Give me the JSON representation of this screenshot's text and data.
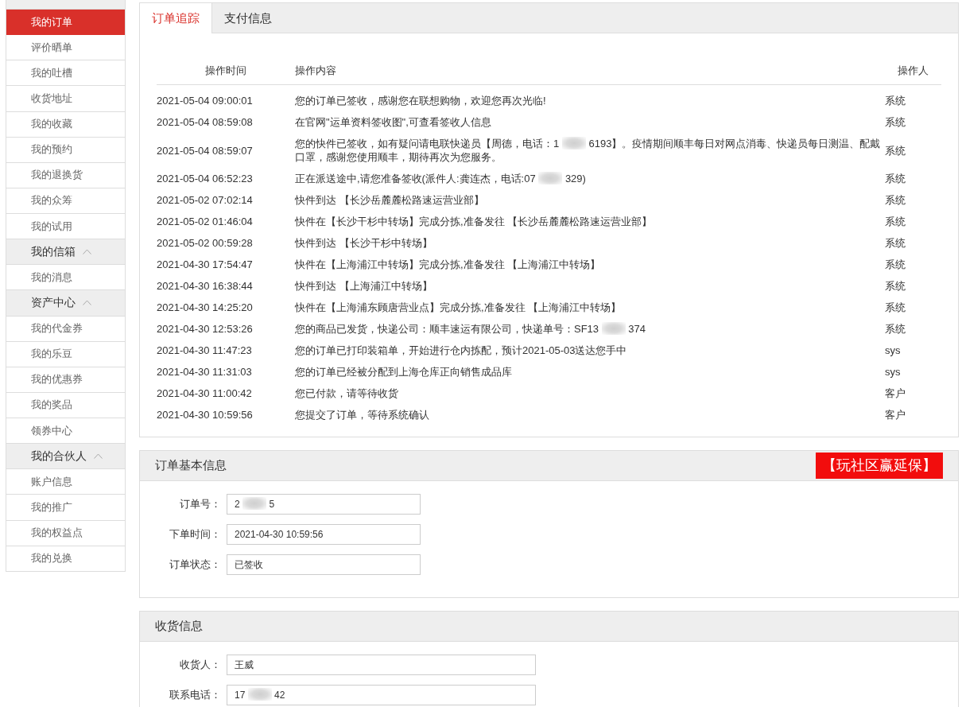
{
  "sidebar": {
    "groups": [
      {
        "items": [
          {
            "label": "我的订单",
            "selected": true
          },
          {
            "label": "评价晒单",
            "selected": false
          },
          {
            "label": "我的吐槽",
            "selected": false
          },
          {
            "label": "收货地址",
            "selected": false
          },
          {
            "label": "我的收藏",
            "selected": false
          },
          {
            "label": "我的预约",
            "selected": false
          },
          {
            "label": "我的退换货",
            "selected": false
          },
          {
            "label": "我的众筹",
            "selected": false
          },
          {
            "label": "我的试用",
            "selected": false
          }
        ]
      },
      {
        "title": "我的信箱",
        "expanded": true,
        "items": [
          {
            "label": "我的消息",
            "selected": false
          }
        ]
      },
      {
        "title": "资产中心",
        "expanded": true,
        "items": [
          {
            "label": "我的代金券",
            "selected": false
          },
          {
            "label": "我的乐豆",
            "selected": false
          },
          {
            "label": "我的优惠券",
            "selected": false
          },
          {
            "label": "我的奖品",
            "selected": false
          },
          {
            "label": "领券中心",
            "selected": false
          }
        ]
      },
      {
        "title": "我的合伙人",
        "expanded": true,
        "items": [
          {
            "label": "账户信息",
            "selected": false
          },
          {
            "label": "我的推广",
            "selected": false
          },
          {
            "label": "我的权益点",
            "selected": false
          },
          {
            "label": "我的兑换",
            "selected": false
          }
        ]
      }
    ]
  },
  "tracking": {
    "tabs": [
      {
        "label": "订单追踪",
        "selected": true
      },
      {
        "label": "支付信息",
        "selected": false
      }
    ],
    "table": {
      "columns": [
        "操作时间",
        "操作内容",
        "操作人"
      ],
      "rows": [
        {
          "time": "2021-05-04 09:00:01",
          "content": [
            "您的订单已签收，感谢您在联想购物，欢迎您再次光临!"
          ],
          "operator": "系统"
        },
        {
          "time": "2021-05-04 08:59:08",
          "content": [
            "在官网\"运单资料签收图\",可查看签收人信息"
          ],
          "operator": "系统"
        },
        {
          "time": "2021-05-04 08:59:07",
          "content": [
            "您的快件已签收，如有疑问请电联快递员【周德，电话：1",
            "6193】。疫情期间顺丰每日对网点消毒、快递员每日测温、配戴口罩，感谢您使用顺丰，期待再次为您服务。"
          ],
          "operator": "系统"
        },
        {
          "time": "2021-05-04 06:52:23",
          "content": [
            "正在派送途中,请您准备签收(派件人:龚连杰，电话:07",
            "329)"
          ],
          "operator": "系统"
        },
        {
          "time": "2021-05-02 07:02:14",
          "content": [
            "快件到达 【长沙岳麓麓松路速运营业部】"
          ],
          "operator": "系统"
        },
        {
          "time": "2021-05-02 01:46:04",
          "content": [
            "快件在【长沙干杉中转场】完成分拣,准备发往 【长沙岳麓麓松路速运营业部】"
          ],
          "operator": "系统"
        },
        {
          "time": "2021-05-02 00:59:28",
          "content": [
            "快件到达 【长沙干杉中转场】"
          ],
          "operator": "系统"
        },
        {
          "time": "2021-04-30 17:54:47",
          "content": [
            "快件在【上海浦江中转场】完成分拣,准备发往 【上海浦江中转场】"
          ],
          "operator": "系统"
        },
        {
          "time": "2021-04-30 16:38:44",
          "content": [
            "快件到达 【上海浦江中转场】"
          ],
          "operator": "系统"
        },
        {
          "time": "2021-04-30 14:25:20",
          "content": [
            "快件在【上海浦东顾唐营业点】完成分拣,准备发往 【上海浦江中转场】"
          ],
          "operator": "系统"
        },
        {
          "time": "2021-04-30 12:53:26",
          "content": [
            "您的商品已发货，快递公司：顺丰速运有限公司，快递单号：SF13",
            "374"
          ],
          "operator": "系统"
        },
        {
          "time": "2021-04-30 11:47:23",
          "content": [
            "您的订单已打印装箱单，开始进行仓内拣配，预计2021-05-03送达您手中"
          ],
          "operator": "sys"
        },
        {
          "time": "2021-04-30 11:31:03",
          "content": [
            "您的订单已经被分配到上海仓库正向销售成品库"
          ],
          "operator": "sys"
        },
        {
          "time": "2021-04-30 11:00:42",
          "content": [
            "您已付款，请等待收货"
          ],
          "operator": "客户"
        },
        {
          "time": "2021-04-30 10:59:56",
          "content": [
            "您提交了订单，等待系统确认"
          ],
          "operator": "客户"
        }
      ]
    }
  },
  "info_panels": [
    {
      "title": "订单基本信息",
      "promo": "【玩社区赢延保】",
      "fields": [
        {
          "label": "订单号：",
          "value": [
            "2",
            "5"
          ]
        },
        {
          "label": "下单时间：",
          "value": [
            "2021-04-30 10:59:56"
          ]
        },
        {
          "label": "订单状态：",
          "value": [
            "已签收"
          ]
        }
      ]
    },
    {
      "title": "收货信息",
      "fields": [
        {
          "label": "收货人：",
          "value": [
            "王威"
          ]
        },
        {
          "label": "联系电话：",
          "value": [
            "17",
            "42"
          ]
        }
      ]
    }
  ]
}
